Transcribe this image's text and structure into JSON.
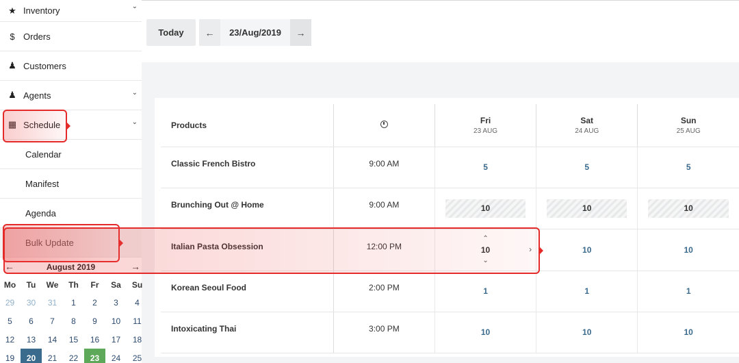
{
  "sidebar": {
    "items": [
      {
        "label": "Inventory",
        "icon": "star-icon",
        "glyph": "★",
        "chevron": true
      },
      {
        "label": "Orders",
        "icon": "dollar-icon",
        "glyph": "$",
        "chevron": false
      },
      {
        "label": "Customers",
        "icon": "person-icon",
        "glyph": "♟",
        "chevron": false
      },
      {
        "label": "Agents",
        "icon": "person-icon",
        "glyph": "♟",
        "chevron": true
      },
      {
        "label": "Schedule",
        "icon": "calendar-icon",
        "glyph": "▦",
        "chevron": true
      }
    ],
    "sub_items": [
      "Calendar",
      "Manifest",
      "Agenda",
      "Bulk Update"
    ],
    "chevron_glyph": "⌄"
  },
  "mini_calendar": {
    "month_label": "August 2019",
    "prev_glyph": "←",
    "next_glyph": "→",
    "weekdays": [
      "Mo",
      "Tu",
      "We",
      "Th",
      "Fr",
      "Sa",
      "Su"
    ],
    "rows": [
      [
        {
          "d": "29",
          "muted": true
        },
        {
          "d": "30",
          "muted": true
        },
        {
          "d": "31",
          "muted": true
        },
        {
          "d": "1"
        },
        {
          "d": "2"
        },
        {
          "d": "3"
        },
        {
          "d": "4"
        }
      ],
      [
        {
          "d": "5"
        },
        {
          "d": "6"
        },
        {
          "d": "7"
        },
        {
          "d": "8"
        },
        {
          "d": "9"
        },
        {
          "d": "10"
        },
        {
          "d": "11"
        }
      ],
      [
        {
          "d": "12"
        },
        {
          "d": "13"
        },
        {
          "d": "14"
        },
        {
          "d": "15"
        },
        {
          "d": "16"
        },
        {
          "d": "17"
        },
        {
          "d": "18"
        }
      ],
      [
        {
          "d": "19"
        },
        {
          "d": "20",
          "state": "selected"
        },
        {
          "d": "21"
        },
        {
          "d": "22"
        },
        {
          "d": "23",
          "state": "today"
        },
        {
          "d": "24"
        },
        {
          "d": "25"
        }
      ]
    ],
    "colors": {
      "selected": "#3a6a8c",
      "today": "#5ea85a"
    }
  },
  "toolbar": {
    "today_label": "Today",
    "prev_glyph": "←",
    "next_glyph": "→",
    "current_date": "23/Aug/2019"
  },
  "schedule": {
    "products_header": "Products",
    "time_header_icon": "clock-icon",
    "days": [
      {
        "name": "Fri",
        "date": "23 AUG"
      },
      {
        "name": "Sat",
        "date": "24 AUG"
      },
      {
        "name": "Sun",
        "date": "25 AUG"
      }
    ],
    "rows": [
      {
        "product": "Classic French Bistro",
        "time": "9:00 AM",
        "cells": [
          {
            "v": "5"
          },
          {
            "v": "5"
          },
          {
            "v": "5"
          }
        ]
      },
      {
        "product": "Brunching Out @ Home",
        "time": "9:00 AM",
        "cells": [
          {
            "v": "10",
            "style": "hatched"
          },
          {
            "v": "10",
            "style": "hatched"
          },
          {
            "v": "10",
            "style": "hatched"
          }
        ]
      },
      {
        "product": "Italian Pasta Obsession",
        "time": "12:00 PM",
        "cells": [
          {
            "v": "10",
            "style": "editing"
          },
          {
            "v": "10",
            "style": "boxed"
          },
          {
            "v": "10",
            "style": "boxed"
          }
        ]
      },
      {
        "product": "Korean Seoul Food",
        "time": "2:00 PM",
        "cells": [
          {
            "v": "1"
          },
          {
            "v": "1"
          },
          {
            "v": "1"
          }
        ]
      },
      {
        "product": "Intoxicating Thai",
        "time": "3:00 PM",
        "cells": [
          {
            "v": "10"
          },
          {
            "v": "10"
          },
          {
            "v": "10"
          }
        ]
      }
    ],
    "edit_glyphs": {
      "up": "⌃",
      "down": "⌄",
      "next": "›"
    }
  },
  "highlight_color": "#e52a2a"
}
